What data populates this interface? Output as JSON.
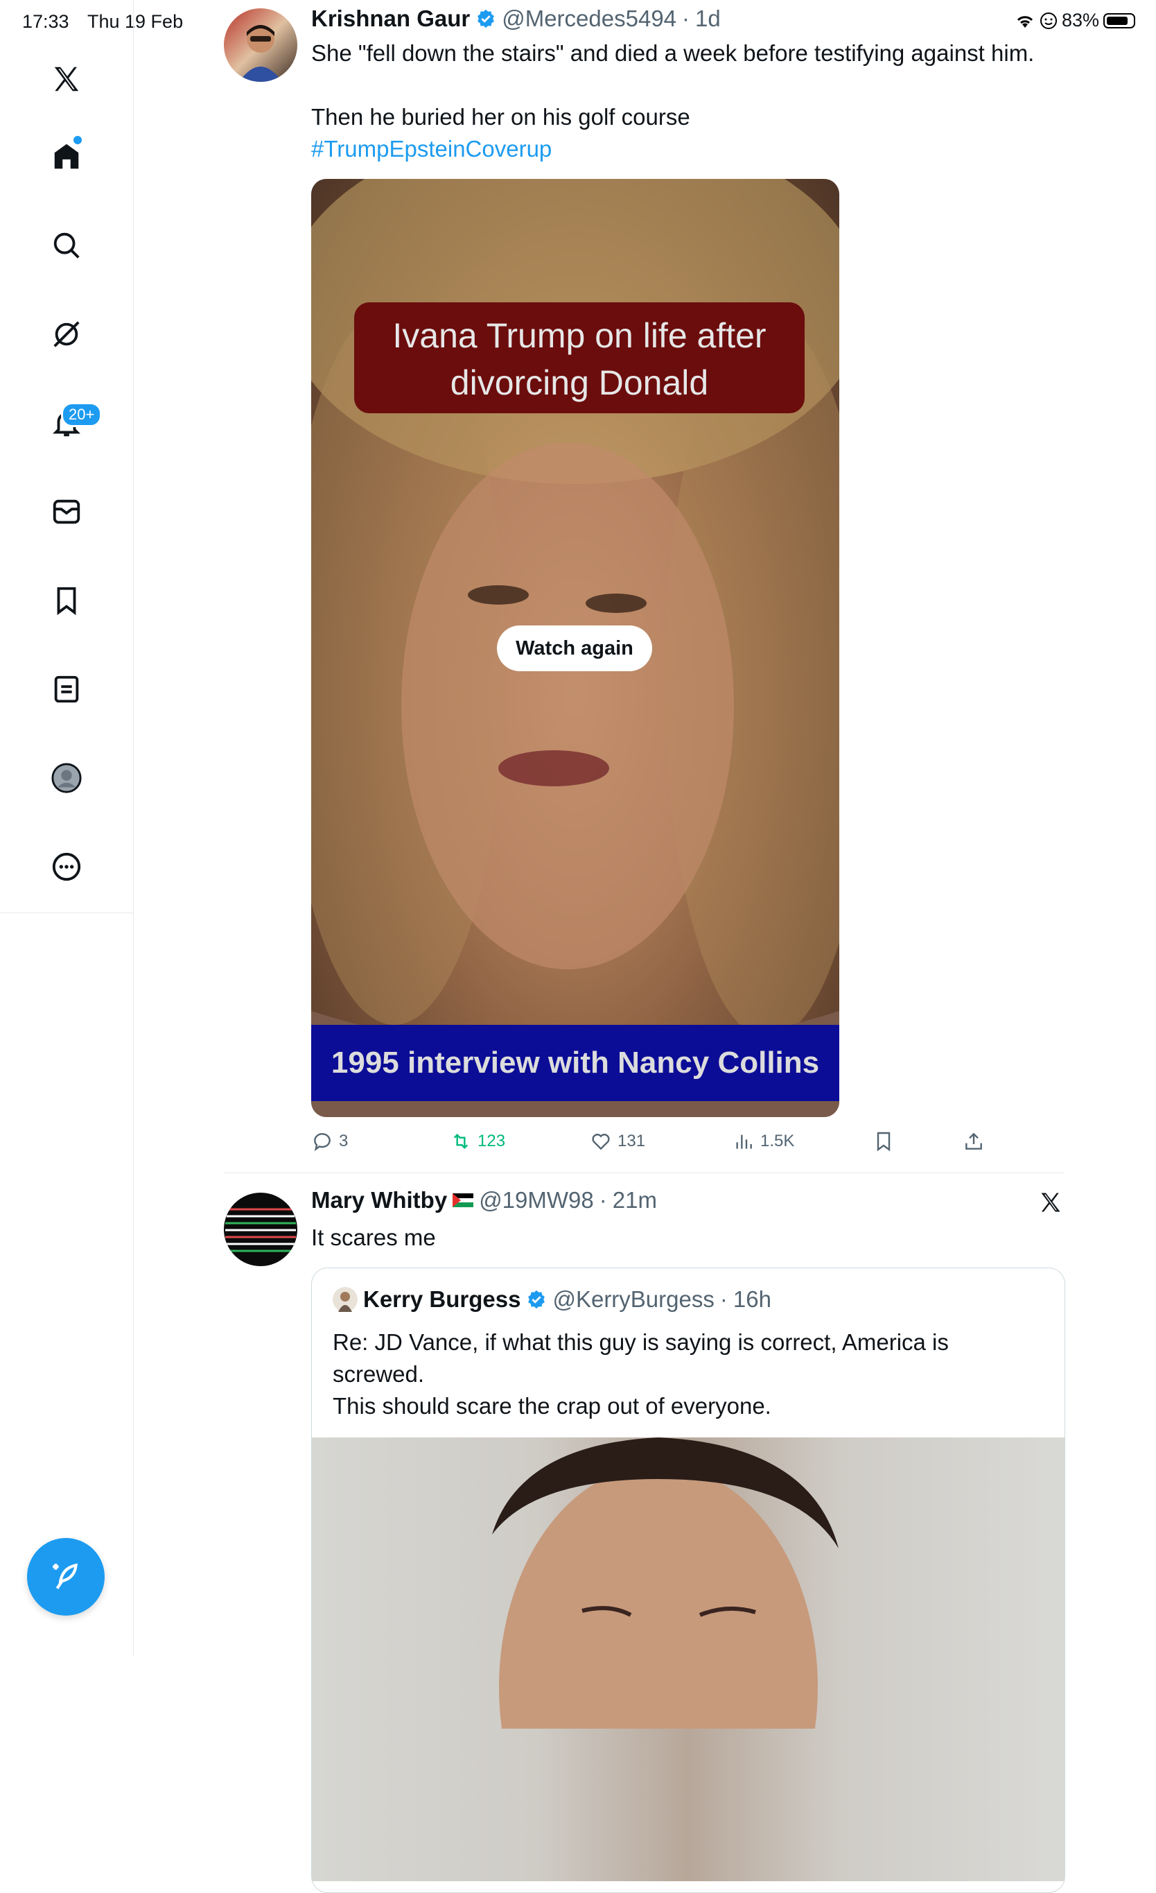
{
  "status_bar": {
    "time": "17:33",
    "date": "Thu 19 Feb",
    "battery": "83%"
  },
  "sidebar": {
    "notifications_badge": "20+"
  },
  "tweets": [
    {
      "name": "Krishnan Gaur",
      "handle": "@Mercedes5494",
      "time": "1d",
      "text_line1": "She \"fell down the stairs\" and died a week before testifying against him.",
      "text_line2": "Then he buried her on his golf course",
      "hashtag": "#TrumpEpsteinCoverup",
      "media": {
        "caption_top": "Ivana Trump on life after divorcing Donald",
        "caption_bottom": "1995 interview with Nancy Collins",
        "watch_again": "Watch again"
      },
      "stats": {
        "replies": "3",
        "retweets": "123",
        "likes": "131",
        "views": "1.5K"
      }
    },
    {
      "name": "Mary Whitby",
      "handle": "@19MW98",
      "time": "21m",
      "text": "It scares me",
      "quote": {
        "name": "Kerry Burgess",
        "handle": "@KerryBurgess",
        "time": "16h",
        "text_line1": "Re: JD Vance, if what this guy is saying is correct, America is screwed.",
        "text_line2": "This should scare the crap out of everyone."
      }
    }
  ],
  "colors": {
    "accent": "#1d9bf0",
    "retweet": "#00ba7c",
    "secondary_text": "#536471"
  }
}
